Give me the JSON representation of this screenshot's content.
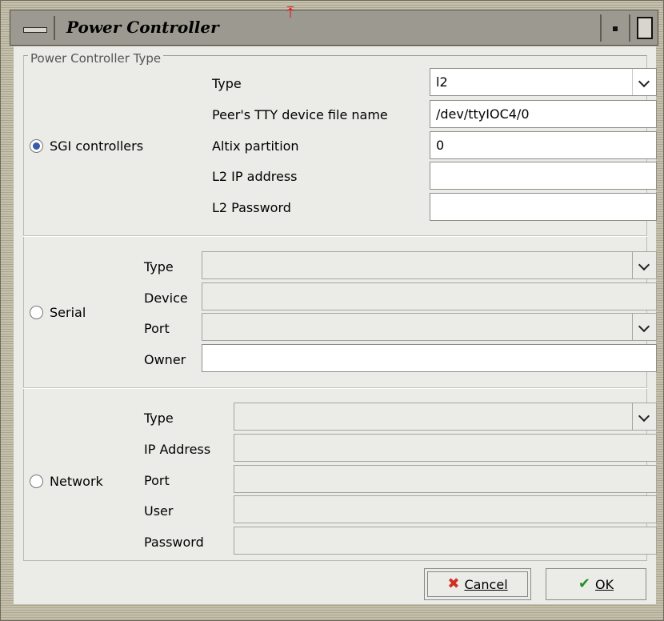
{
  "window": {
    "title": "Power Controller",
    "colors": {
      "radio_accent": "#3b5cae",
      "cancel_icon": "#d03020",
      "ok_icon": "#2a8f2a"
    },
    "icons": [
      "window-menu-icon",
      "minimize-icon",
      "maximize-icon",
      "red-pin-icon"
    ]
  },
  "group_title": "Power Controller Type",
  "sgi": {
    "radio_label": "SGI controllers",
    "selected": true,
    "type_label": "Type",
    "type_value": "l2",
    "tty_label": "Peer's TTY device file name",
    "tty_value": "/dev/ttyIOC4/0",
    "partition_label": "Altix partition",
    "partition_value": "0",
    "ip_label": "L2 IP address",
    "ip_value": "",
    "password_label": "L2 Password",
    "password_value": ""
  },
  "serial": {
    "radio_label": "Serial",
    "selected": false,
    "type_label": "Type",
    "device_label": "Device",
    "port_label": "Port",
    "owner_label": "Owner"
  },
  "network": {
    "radio_label": "Network",
    "selected": false,
    "type_label": "Type",
    "ip_label": "IP Address",
    "port_label": "Port",
    "user_label": "User",
    "password_label": "Password"
  },
  "buttons": {
    "cancel_label": "Cancel",
    "ok_label": "OK"
  }
}
